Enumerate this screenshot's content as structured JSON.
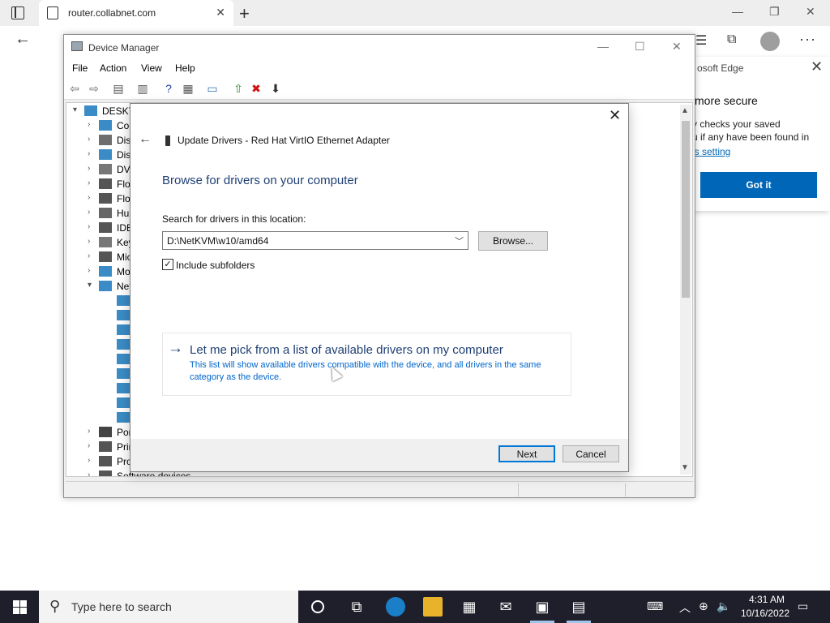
{
  "browser": {
    "tab_title": "router.collabnet.com",
    "tab_close": "✕",
    "new_tab": "+",
    "window_controls": [
      "—",
      "❐",
      "✕"
    ],
    "back": "←"
  },
  "edge_popup": {
    "header": "osoft Edge",
    "close": "✕",
    "heading": "more secure",
    "line1": "y checks your saved",
    "line2": "u if any have been found in",
    "link": "is setting",
    "button": "Got it"
  },
  "device_manager": {
    "title": "Device Manager",
    "window_controls": [
      "—",
      "☐",
      "✕"
    ],
    "menu": [
      "File",
      "Action",
      "View",
      "Help"
    ],
    "toolbar_icons": [
      {
        "name": "back-icon",
        "glyph": "⇦",
        "color": "#6a6a6a"
      },
      {
        "name": "forward-icon",
        "glyph": "⇨",
        "color": "#6a6a6a"
      },
      {
        "name": "show-hide-console-tree-icon",
        "glyph": "▤",
        "color": "#555555"
      },
      {
        "name": "properties-icon",
        "glyph": "▥",
        "color": "#555555"
      },
      {
        "name": "help-icon",
        "glyph": "?",
        "color": "#1f3f99"
      },
      {
        "name": "view-icon",
        "glyph": "▦",
        "color": "#555555"
      },
      {
        "name": "monitor-icon",
        "glyph": "▭",
        "color": "#2a6db5"
      },
      {
        "name": "update-driver-icon",
        "glyph": "⇧",
        "color": "#2a8a2a"
      },
      {
        "name": "uninstall-icon",
        "glyph": "✖",
        "color": "#d01010"
      },
      {
        "name": "scan-hardware-icon",
        "glyph": "⬇",
        "color": "#333333"
      }
    ],
    "tree": [
      {
        "label": "DESKTO",
        "expander": "▾",
        "icon": "computer-icon",
        "level": 0
      },
      {
        "label": "Cor",
        "expander": "›",
        "icon": "computer-icon",
        "level": 1
      },
      {
        "label": "Disl",
        "expander": "›",
        "icon": "disk-icon",
        "level": 1
      },
      {
        "label": "Disp",
        "expander": "›",
        "icon": "display-icon",
        "level": 1
      },
      {
        "label": "DVD",
        "expander": "›",
        "icon": "dvd-icon",
        "level": 1
      },
      {
        "label": "Flop",
        "expander": "›",
        "icon": "floppy-icon",
        "level": 1
      },
      {
        "label": "Flop",
        "expander": "›",
        "icon": "floppy-icon",
        "level": 1
      },
      {
        "label": "Hun",
        "expander": "›",
        "icon": "hid-icon",
        "level": 1
      },
      {
        "label": "IDE",
        "expander": "›",
        "icon": "ide-icon",
        "level": 1
      },
      {
        "label": "Key",
        "expander": "›",
        "icon": "keyboard-icon",
        "level": 1
      },
      {
        "label": "Mic",
        "expander": "›",
        "icon": "mouse-icon",
        "level": 1
      },
      {
        "label": "Mo",
        "expander": "›",
        "icon": "monitor-icon",
        "level": 1
      },
      {
        "label": "Net",
        "expander": "▾",
        "icon": "network-adapter-icon",
        "level": 1
      }
    ],
    "net_children_count_label": "",
    "tree_bottom": [
      {
        "label": "Por",
        "expander": "›",
        "icon": "port-icon"
      },
      {
        "label": "Prin",
        "expander": "›",
        "icon": "printer-icon"
      },
      {
        "label": "Pro",
        "expander": "›",
        "icon": "processor-icon"
      },
      {
        "label": "Software devices",
        "expander": "›",
        "icon": "software-device-icon"
      }
    ]
  },
  "dialog": {
    "close": "✕",
    "back": "←",
    "header": "Update Drivers - Red Hat VirtIO Ethernet Adapter",
    "heading": "Browse for drivers on your computer",
    "search_label": "Search for drivers in this location:",
    "path_value": "D:\\NetKVM\\w10/amd64",
    "browse_label": "Browse...",
    "include_subfolders_label": "Include subfolders",
    "include_subfolders_checked": true,
    "checkmark": "✓",
    "pick_arrow": "→",
    "pick_title": "Let me pick from a list of available drivers on my computer",
    "pick_desc": "This list will show available drivers compatible with the device, and all drivers in the same category as the device.",
    "next_label": "Next",
    "cancel_label": "Cancel"
  },
  "taskbar": {
    "search_placeholder": "Type here to search",
    "time": "4:31 AM",
    "date": "10/16/2022",
    "apps": [
      "task-view-icon",
      "edge-icon",
      "file-explorer-icon",
      "store-icon",
      "mail-icon",
      "server-manager-icon",
      "device-manager-icon"
    ]
  }
}
